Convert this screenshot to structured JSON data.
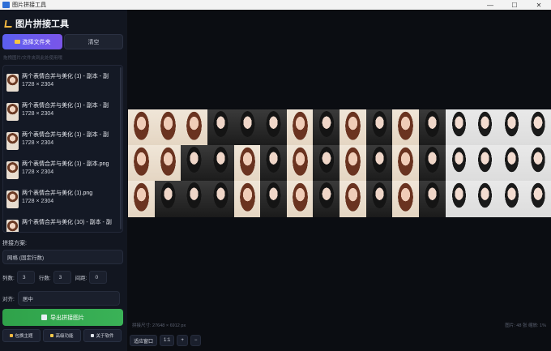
{
  "window": {
    "title": "图片拼接工具",
    "controls": [
      "—",
      "☐",
      "✕"
    ]
  },
  "sidebar": {
    "brand": "图片拼接工具",
    "select_files": "选择文件夹",
    "clear": "清空",
    "hint": "拖拽图片/文件夹到此处使用哦",
    "files": [
      {
        "name": "两个表情合并与美化 (1) - 副本 - 副",
        "size": "1728 × 2304"
      },
      {
        "name": "两个表情合并与美化 (1) - 副本 - 副",
        "size": "1728 × 2304"
      },
      {
        "name": "两个表情合并与美化 (1) - 副本 - 副",
        "size": "1728 × 2304"
      },
      {
        "name": "两个表情合并与美化 (1) - 副本.png",
        "size": "1728 × 2304"
      },
      {
        "name": "两个表情合并与美化 (1).png",
        "size": "1728 × 2304"
      },
      {
        "name": "两个表情合并与美化 (10) - 副本 - 副",
        "size": ""
      }
    ],
    "scheme_label": "拼接方案:",
    "scheme_value": "网格 (固定行数)",
    "cols_label": "列数:",
    "cols_value": "3",
    "rows_label": "行数:",
    "rows_value": "3",
    "gap_label": "间距:",
    "gap_value": "0",
    "align_label": "对齐:",
    "align_value": "居中",
    "export": "导出拼接图片",
    "theme_btn": "包换主题",
    "feature_btn": "高级功能",
    "about_btn": "关于软件"
  },
  "main": {
    "status_left": "拼接尺寸: 27648 × 6912 px",
    "status_right": "图片: 48 张  缩放: 1%",
    "zoom_fit": "适应窗口",
    "zoom_100": "1:1",
    "zoom_in": "+",
    "zoom_out": "−"
  },
  "colors": {
    "accent": "#5b5ff0",
    "success": "#3ab257",
    "sidebar": "#121620",
    "background": "#0b0d12"
  }
}
